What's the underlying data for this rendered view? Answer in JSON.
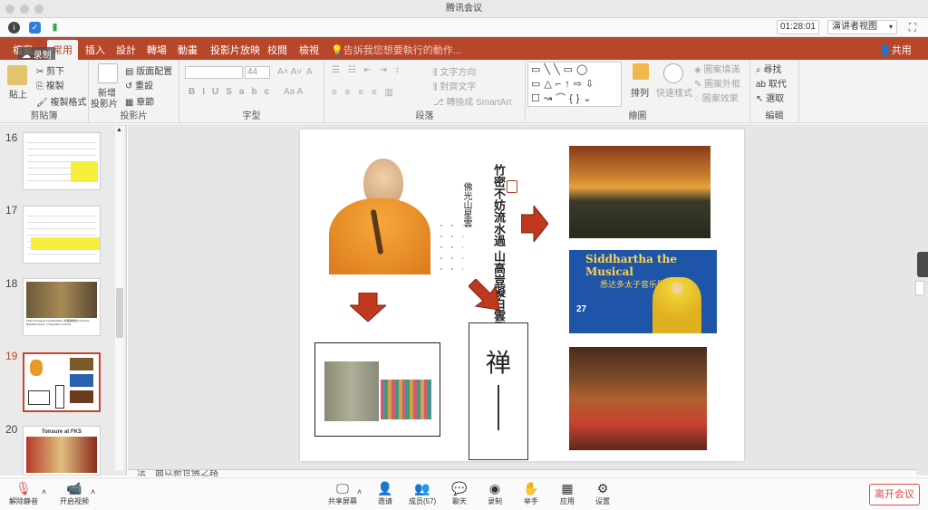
{
  "window": {
    "title": "腾讯会议"
  },
  "meeting": {
    "timer": "01:28:01",
    "view_mode": "演讲者视图"
  },
  "recording": {
    "label": "录制"
  },
  "ribbon_tabs": [
    "檔案",
    "常用",
    "插入",
    "設計",
    "轉場",
    "動畫",
    "投影片放映",
    "校閱",
    "檢視"
  ],
  "ribbon": {
    "tell_me": "告訴我您想要執行的動作...",
    "share": "共用",
    "clipboard": {
      "paste": "貼上",
      "cut": "剪下",
      "copy": "複製",
      "format_painter": "複製格式",
      "label": "剪貼簿"
    },
    "slides": {
      "new_slide": "新增",
      "new_slide2": "投影片",
      "layout": "版面配置",
      "reset": "重設",
      "section": "章節",
      "label": "投影片"
    },
    "font": {
      "size": "44",
      "label": "字型"
    },
    "paragraph": {
      "text_direction": "文字方向",
      "align_text": "對齊文字",
      "smartart": "轉換成 SmartArt",
      "label": "段落"
    },
    "drawing": {
      "arrange": "排列",
      "quick_styles": "快速樣式",
      "shape_fill": "圖案填滿",
      "shape_outline": "圖案外框",
      "shape_effects": "圖案效果",
      "label": "繪圖"
    },
    "editing": {
      "find": "尋找",
      "replace": "取代",
      "select": "選取",
      "label": "編輯"
    }
  },
  "slides_panel": [
    {
      "num": "16"
    },
    {
      "num": "17"
    },
    {
      "num": "18",
      "caption": "1943 Chungkuo Fuchiaohsieh (中國佛教會) Chinese Buddhist Assoc. of Republic of China"
    },
    {
      "num": "19",
      "selected": true
    },
    {
      "num": "20",
      "caption": "Tonsure at FKS"
    }
  ],
  "slide": {
    "calligraphy_cols": [
      "竹密不妨流水過",
      "山高豈礙白雲飛",
      "佛光山星雲"
    ],
    "banner_title": "Siddhartha the Musical",
    "banner_subtitle": "悉达多太子音乐剧",
    "banner_date": "27",
    "zen_char": "禅"
  },
  "notes": {
    "text": "法　面以新世佛之路"
  },
  "bottom_bar": {
    "mute": "解除静音",
    "video": "开启视频",
    "share": "共享屏幕",
    "invite": "邀请",
    "members": "成员(57)",
    "chat": "聊天",
    "record": "录制",
    "raise_hand": "举手",
    "apps": "应用",
    "settings": "设置",
    "leave": "离开会议"
  },
  "colors": {
    "accent": "#b7472a",
    "leave": "#e24b4b",
    "selected": "#c4452a"
  }
}
